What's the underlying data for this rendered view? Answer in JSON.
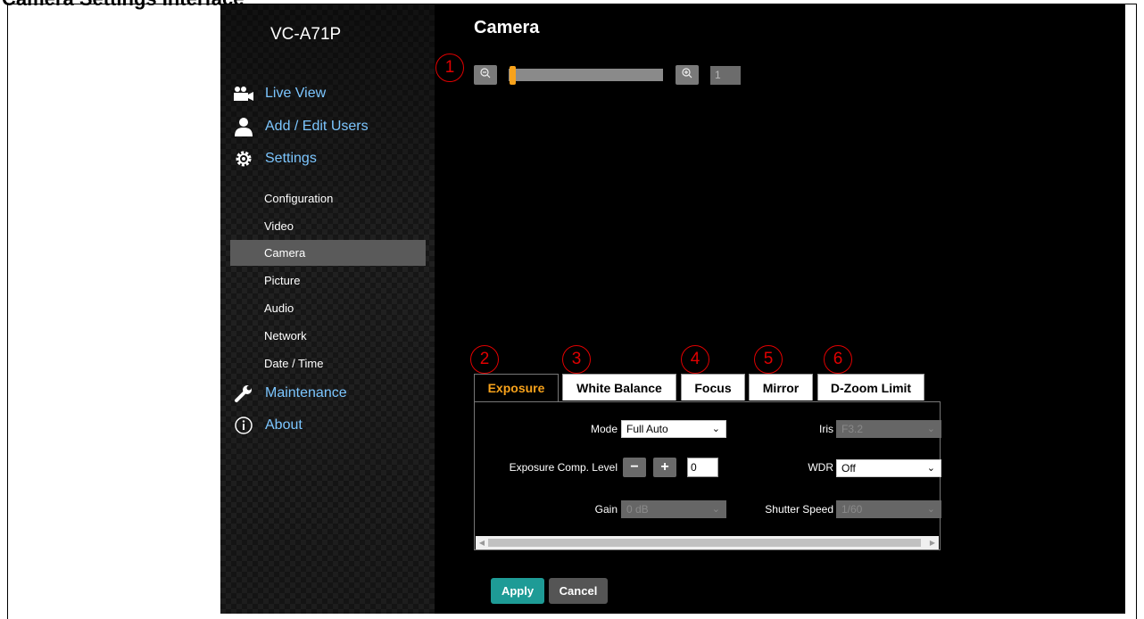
{
  "document": {
    "heading": "Camera Settings Interface"
  },
  "sidebar": {
    "device_name": "VC-A71P",
    "main_items": [
      {
        "label": "Live View",
        "icon": "video-camera-icon"
      },
      {
        "label": "Add / Edit Users",
        "icon": "user-icon"
      },
      {
        "label": "Settings",
        "icon": "gear-icon"
      },
      {
        "label": "Maintenance",
        "icon": "wrench-icon"
      },
      {
        "label": "About",
        "icon": "info-icon"
      }
    ],
    "settings_items": [
      {
        "label": "Configuration",
        "active": false
      },
      {
        "label": "Video",
        "active": false
      },
      {
        "label": "Camera",
        "active": true
      },
      {
        "label": "Picture",
        "active": false
      },
      {
        "label": "Audio",
        "active": false
      },
      {
        "label": "Network",
        "active": false
      },
      {
        "label": "Date / Time",
        "active": false
      }
    ],
    "active_bg": "#5a5a5a",
    "link_color": "#7cc6ff"
  },
  "main": {
    "title": "Camera",
    "zoom": {
      "value": "1",
      "level": 0.0,
      "zoom_out_icon": "zoom-out-icon",
      "zoom_in_icon": "zoom-in-icon"
    },
    "callouts": [
      "1",
      "2",
      "3",
      "4",
      "5",
      "6"
    ],
    "callout_color": "#e00000",
    "tabs": [
      {
        "label": "Exposure",
        "active": true
      },
      {
        "label": "White Balance",
        "active": false
      },
      {
        "label": "Focus",
        "active": false
      },
      {
        "label": "Mirror",
        "active": false
      },
      {
        "label": "D-Zoom Limit",
        "active": false
      }
    ],
    "accent": "#f7a21b",
    "exposure": {
      "mode_label": "Mode",
      "mode_value": "Full Auto",
      "exp_comp_label": "Exposure Comp. Level",
      "exp_comp_minus": "−",
      "exp_comp_plus": "+",
      "exp_comp_value": "0",
      "gain_label": "Gain",
      "gain_value": "0 dB",
      "iris_label": "Iris",
      "iris_value": "F3.2",
      "wdr_label": "WDR",
      "wdr_value": "Off",
      "shutter_label": "Shutter Speed",
      "shutter_value": "1/60"
    },
    "buttons": {
      "apply": "Apply",
      "cancel": "Cancel",
      "apply_color": "#1e9b96",
      "cancel_color": "#555555"
    }
  }
}
